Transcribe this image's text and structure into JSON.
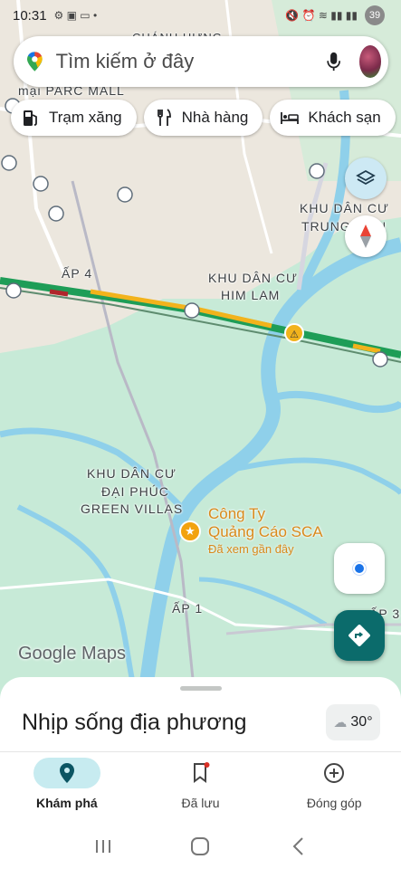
{
  "status_bar": {
    "time": "10:31",
    "battery": "39"
  },
  "search": {
    "placeholder": "Tìm kiếm ở đây"
  },
  "chips": [
    {
      "label": "Trạm xăng",
      "icon": "gas-station-icon"
    },
    {
      "label": "Nhà hàng",
      "icon": "restaurant-icon"
    },
    {
      "label": "Khách sạn",
      "icon": "hotel-icon"
    }
  ],
  "map": {
    "labels": {
      "chanh_hung": "CHÁNH HƯNG",
      "parc_mall": "mại PARC MALL",
      "ap4": "ẤP 4",
      "him_lam_1": "KHU DÂN CƯ",
      "him_lam_2": "HIM LAM",
      "trung_son_1": "KHU DÂN CƯ",
      "trung_son_2": "TRUNG SƠN",
      "dai_phuc_1": "KHU DÂN CƯ",
      "dai_phuc_2": "ĐẠI PHÚC",
      "dai_phuc_3": "GREEN VILLAS",
      "ap1": "ẤP 1",
      "ap3": "ẤP 3"
    },
    "poi": {
      "name_line1": "Công Ty",
      "name_line2": "Quảng Cáo SCA",
      "subtitle": "Đã xem gần đây"
    },
    "attribution": "Google Maps"
  },
  "sheet": {
    "title": "Nhịp sống địa phương",
    "temperature": "30°"
  },
  "bottom_nav": [
    {
      "label": "Khám phá",
      "active": true
    },
    {
      "label": "Đã lưu",
      "active": false
    },
    {
      "label": "Đóng góp",
      "active": false
    }
  ],
  "colors": {
    "accent": "#0b6b6b",
    "water": "#8fd0ea",
    "park": "#bfe8cf",
    "highway_green": "#1e9d57",
    "highway_yellow": "#f2b31c",
    "poi": "#d9891b"
  }
}
